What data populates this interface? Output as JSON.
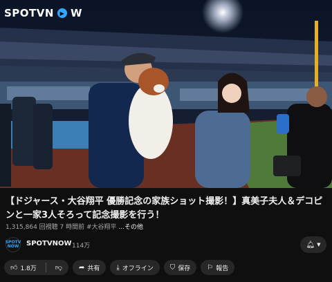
{
  "video": {
    "watermark_left": "SPOTV",
    "watermark_o": "O",
    "watermark_right": "W",
    "watermark_pre_o": "N"
  },
  "title": "【ドジャース・大谷翔平 優勝記念の家族ショット撮影！】真美子夫人＆デコピンと一家3人そろって記念撮影を行う！",
  "meta": {
    "views": "1,315,864 回視聴",
    "age": "7 時間前",
    "tag": "#大谷翔平",
    "more": "...その他"
  },
  "channel": {
    "avatar_text": "SPOTV NOW",
    "name": "SPOTVNOW",
    "subs": "114万",
    "bell_icon": "bell-icon"
  },
  "actions": {
    "like_count": "1.8万",
    "share": "共有",
    "offline": "オフライン",
    "save": "保存",
    "report": "報告"
  },
  "colors": {
    "background": "#0f0f0f",
    "pill": "#272727",
    "brand": "#2ea8ff"
  }
}
